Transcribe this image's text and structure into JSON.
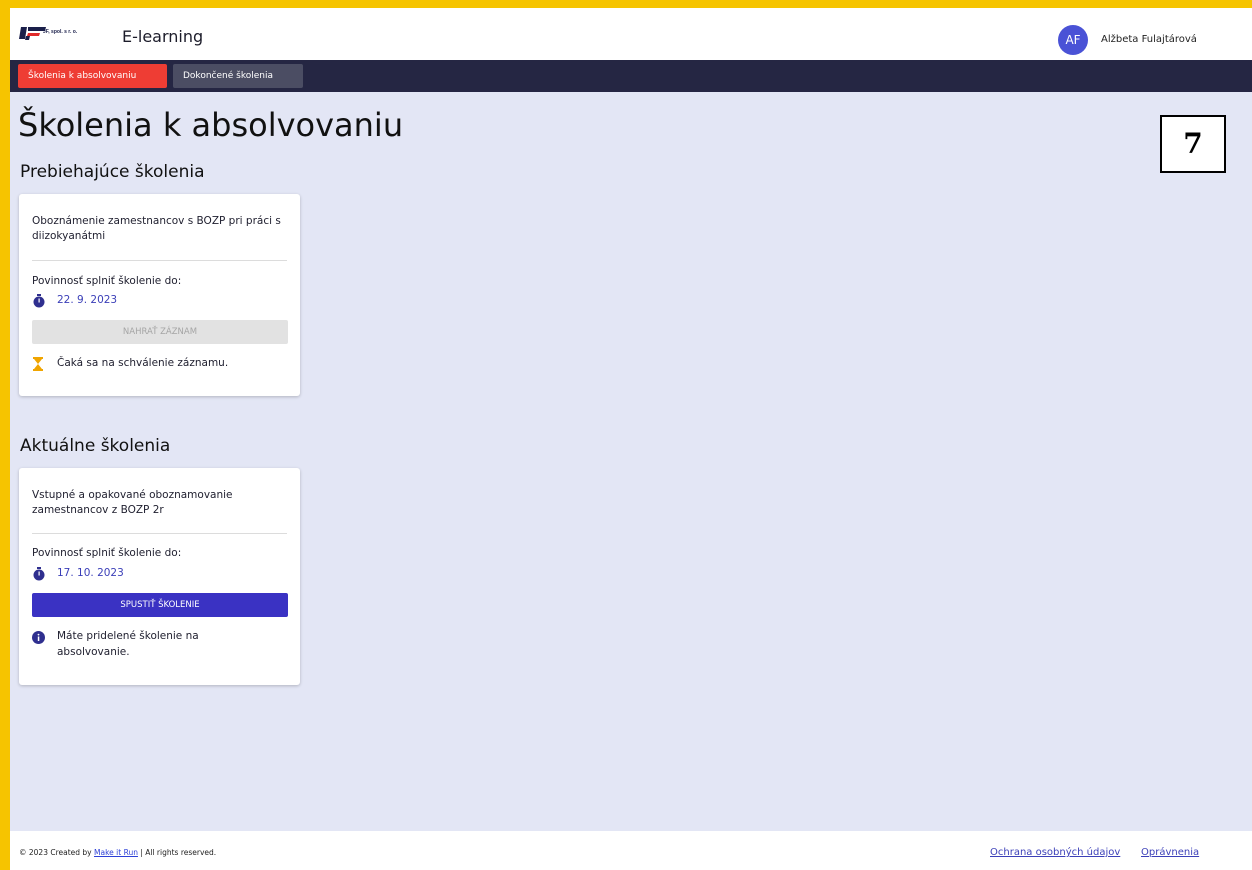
{
  "header": {
    "logo_text": "JF, spol. s r. o.",
    "app_title": "E-learning",
    "user_initials": "AF",
    "user_name": "Alžbeta Fulajtárová"
  },
  "nav": {
    "tabs": [
      {
        "label": "Školenia k absolvovaniu",
        "active": true
      },
      {
        "label": "Dokončené školenia",
        "active": false
      }
    ]
  },
  "main": {
    "page_title": "Školenia k absolvovaniu",
    "badge": "7",
    "sections": [
      {
        "title": "Prebiehajúce školenia",
        "card": {
          "title": "Oboznámenie zamestnancov s BOZP pri práci s diizokyanátmi",
          "due_label": "Povinnosť splniť školenie do:",
          "due_date": "22. 9. 2023",
          "button_label": "NAHRAŤ ZÁZNAM",
          "button_enabled": false,
          "status_icon": "hourglass-icon",
          "status_text": "Čaká sa na schválenie záznamu."
        }
      },
      {
        "title": "Aktuálne školenia",
        "card": {
          "title": "Vstupné a opakované oboznamovanie zamestnancov z BOZP 2r",
          "due_label": "Povinnosť splniť školenie do:",
          "due_date": "17. 10. 2023",
          "button_label": "SPUSTIŤ ŠKOLENIE",
          "button_enabled": true,
          "status_icon": "info-icon",
          "status_text": "Máte pridelené školenie na absolvovanie."
        }
      }
    ]
  },
  "footer": {
    "copyright_prefix": "© 2023 Created by ",
    "copyright_link": "Make it Run",
    "copyright_suffix": " | All rights reserved.",
    "links": [
      "Ochrana osobných údajov",
      "Oprávnenia"
    ]
  },
  "colors": {
    "accent": "#3a32c3",
    "active_tab": "#ee3d34",
    "nav_bg": "#252643",
    "page_bg": "#e3e6f5",
    "frame": "#f6c400"
  }
}
